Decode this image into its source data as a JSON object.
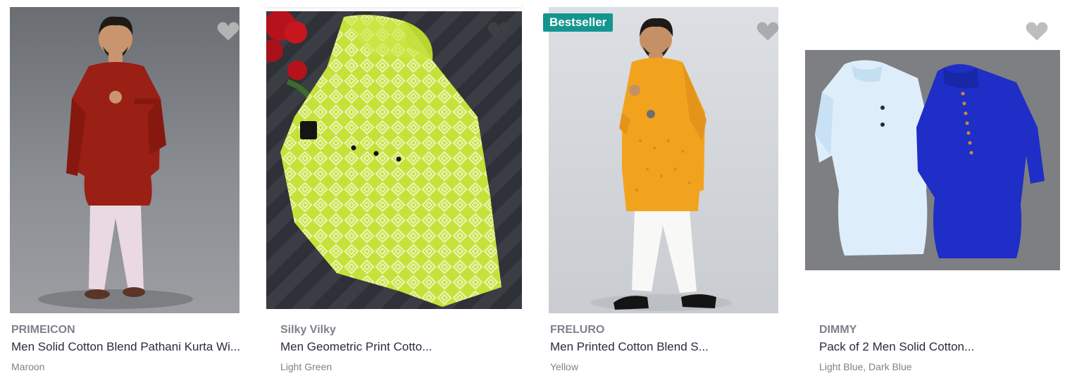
{
  "products": [
    {
      "brand": "PRIMEICON",
      "title": "Men Solid Cotton Blend Pathani Kurta Wi...",
      "color": "Maroon",
      "badge": ""
    },
    {
      "brand": "Silky Vilky",
      "title": "Men Geometric Print Cotto...",
      "color": "Light Green",
      "badge": ""
    },
    {
      "brand": "FRELURO",
      "title": "Men Printed Cotton Blend S...",
      "color": "Yellow",
      "badge": "Bestseller"
    },
    {
      "brand": "DIMMY",
      "title": "Pack of 2 Men Solid Cotton...",
      "color": "Light Blue, Dark Blue",
      "badge": ""
    }
  ],
  "icons": {
    "wishlist": "heart-icon"
  },
  "colors": {
    "badge_bg": "#14958f",
    "heart": "#b3b3b3"
  }
}
